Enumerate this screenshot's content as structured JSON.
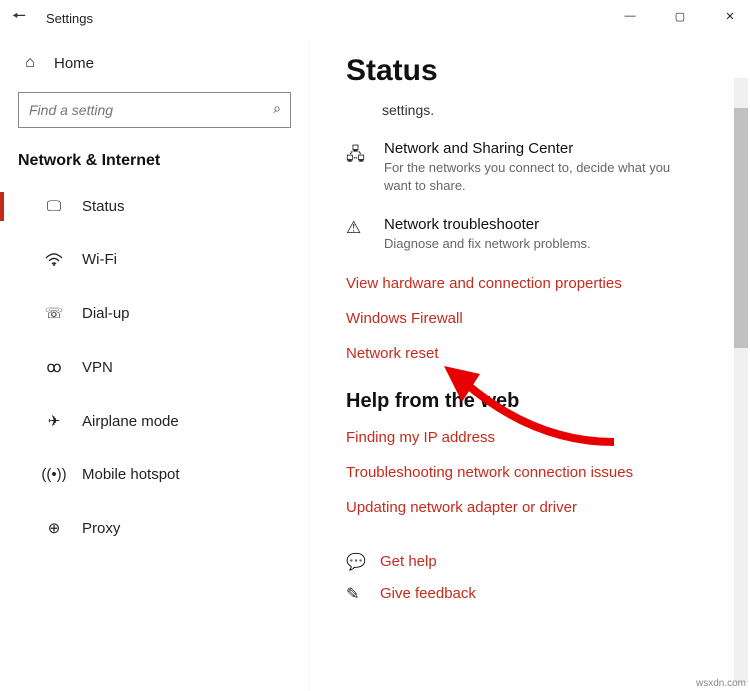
{
  "window": {
    "title": "Settings"
  },
  "sidebar": {
    "home": "Home",
    "search_placeholder": "Find a setting",
    "category": "Network & Internet",
    "items": [
      {
        "label": "Status"
      },
      {
        "label": "Wi-Fi"
      },
      {
        "label": "Dial-up"
      },
      {
        "label": "VPN"
      },
      {
        "label": "Airplane mode"
      },
      {
        "label": "Mobile hotspot"
      },
      {
        "label": "Proxy"
      }
    ]
  },
  "main": {
    "heading": "Status",
    "sub": "settings.",
    "items": [
      {
        "title": "Network and Sharing Center",
        "desc": "For the networks you connect to, decide what you want to share."
      },
      {
        "title": "Network troubleshooter",
        "desc": "Diagnose and fix network problems."
      }
    ],
    "links": [
      "View hardware and connection properties",
      "Windows Firewall",
      "Network reset"
    ],
    "help_heading": "Help from the web",
    "help_links": [
      "Finding my IP address",
      "Troubleshooting network connection issues",
      "Updating network adapter or driver"
    ],
    "feedback": [
      "Get help",
      "Give feedback"
    ]
  },
  "watermark": "wsxdn.com"
}
